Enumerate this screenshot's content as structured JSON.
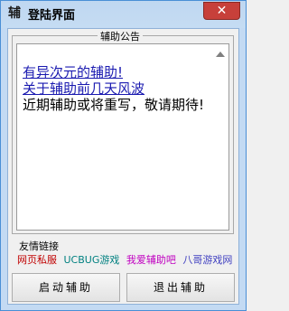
{
  "window": {
    "icon_glyph": "辅",
    "title": "登陆界面",
    "close_glyph": "✕"
  },
  "notice": {
    "legend": "辅助公告",
    "links": [
      "有异次元的辅助!",
      "关于辅助前几天风波"
    ],
    "text": "近期辅助或将重写，敬请期待!"
  },
  "friend_links": {
    "label": "友情链接",
    "items": [
      "网页私服",
      "UCBUG游戏",
      "我爱辅助吧",
      "八哥游戏网"
    ]
  },
  "buttons": {
    "start": "启动辅助",
    "exit": "退出辅助"
  },
  "colors": {
    "window_frame": "#c3daf3",
    "close_button": "#c7403a",
    "link": "#1a1ab0"
  }
}
